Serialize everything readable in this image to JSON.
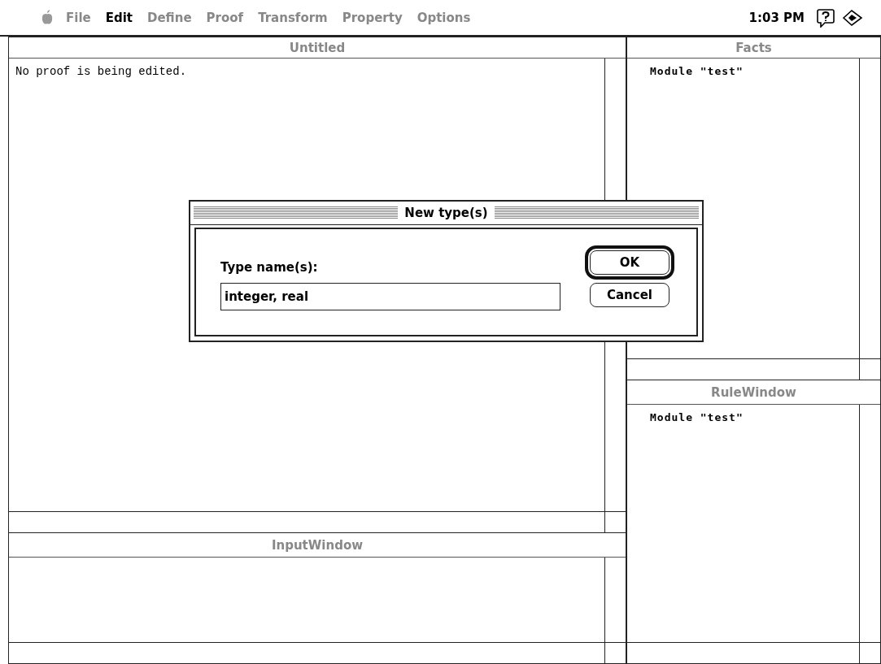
{
  "menu_bar": {
    "items": [
      {
        "label": "File",
        "disabled": true
      },
      {
        "label": "Edit",
        "disabled": false
      },
      {
        "label": "Define",
        "disabled": true
      },
      {
        "label": "Proof",
        "disabled": true
      },
      {
        "label": "Transform",
        "disabled": true
      },
      {
        "label": "Property",
        "disabled": true
      },
      {
        "label": "Options",
        "disabled": true
      }
    ],
    "clock": "1:03 PM"
  },
  "windows": [
    {
      "title": "Untitled",
      "active": false,
      "text": "No proof is being edited.",
      "kind": "mono"
    },
    {
      "title": "Facts",
      "active": false,
      "text": "Module \"test\"",
      "kind": "bold"
    },
    {
      "title": "RuleWindow",
      "active": false,
      "text": "Module \"test\"",
      "kind": "bold"
    },
    {
      "title": "InputWindow",
      "active": false,
      "kind": "empty"
    }
  ],
  "dialog": {
    "title": "New type(s)",
    "label": "Type name(s):",
    "field_value": "integer, real",
    "buttons": [
      {
        "label": "OK",
        "default": true
      },
      {
        "label": "Cancel",
        "default": false
      }
    ]
  }
}
